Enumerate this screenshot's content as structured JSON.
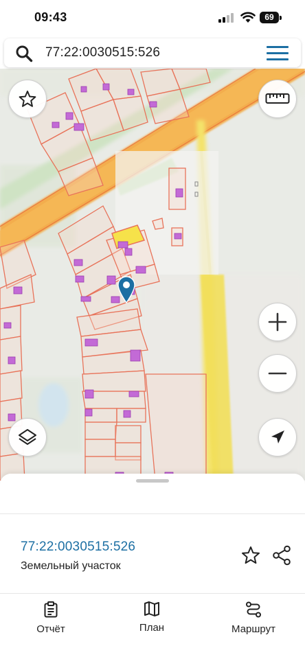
{
  "status_bar": {
    "time": "09:43",
    "battery": "69"
  },
  "search": {
    "query": "77:22:0030515:526"
  },
  "map": {
    "icons": [
      "star-icon",
      "ruler-icon",
      "zoom-in-icon",
      "zoom-out-icon",
      "layers-icon",
      "locate-arrow-icon",
      "location-pin-icon"
    ],
    "colors": {
      "parcel_border": "#e8735a",
      "building": "#c36ad6",
      "road": "#f2b44a",
      "selected_parcel": "#f6e24a",
      "pin": "#1c6fa3"
    }
  },
  "sheet": {
    "parcel_id": "77:22:0030515:526",
    "parcel_type": "Земельный участок",
    "icons": [
      "star-icon",
      "share-icon"
    ]
  },
  "tabs": [
    {
      "label": "Отчёт",
      "icon": "report-clipboard-icon"
    },
    {
      "label": "План",
      "icon": "map-plan-icon"
    },
    {
      "label": "Маршрут",
      "icon": "route-icon"
    }
  ],
  "colors": {
    "accent": "#1c6fa3"
  }
}
